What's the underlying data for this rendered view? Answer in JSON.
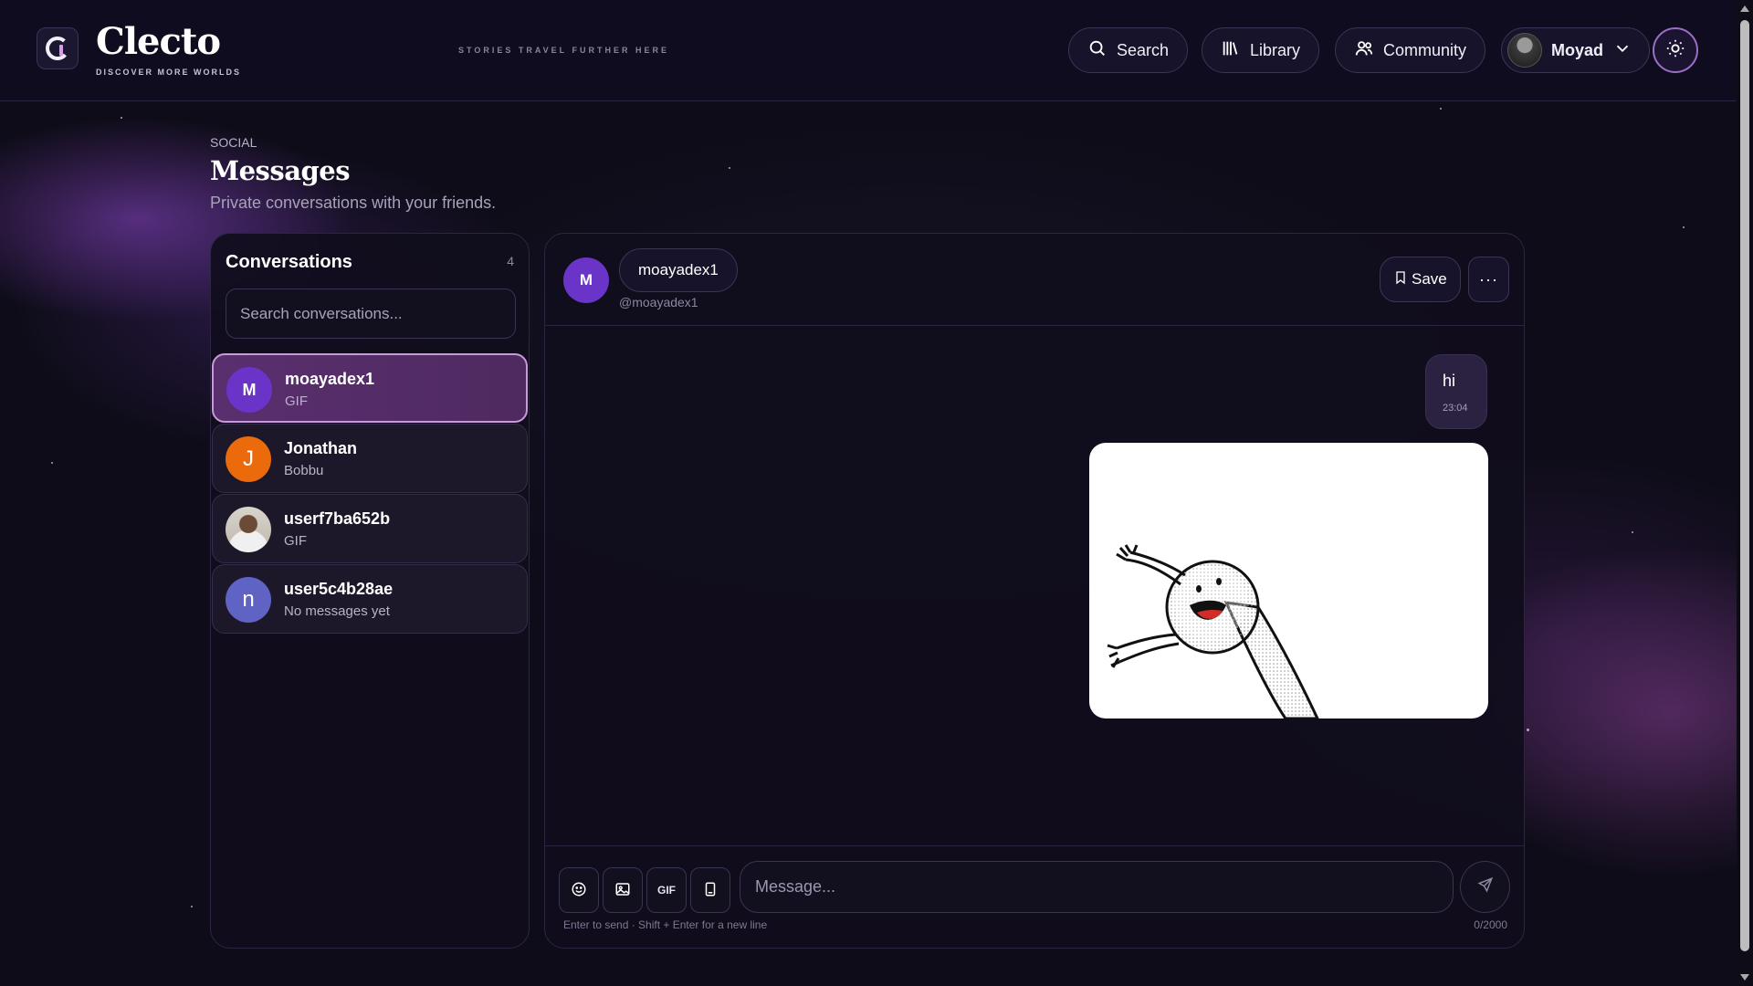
{
  "header": {
    "brand": "Clecto",
    "brand_tagline": "DISCOVER MORE WORLDS",
    "tagline": "STORIES TRAVEL FURTHER HERE",
    "nav": {
      "search": "Search",
      "library": "Library",
      "community": "Community",
      "user": "Moyad"
    }
  },
  "page": {
    "eyebrow": "SOCIAL",
    "title": "Messages",
    "subtitle": "Private conversations with your friends."
  },
  "conversations": {
    "title": "Conversations",
    "count": "4",
    "search_placeholder": "Search conversations...",
    "items": [
      {
        "initial": "M",
        "name": "moayadex1",
        "preview": "GIF",
        "color": "#6a34c8"
      },
      {
        "initial": "J",
        "name": "Jonathan",
        "preview": "Bobbu",
        "color": "#ea6a0c"
      },
      {
        "initial": "",
        "name": "userf7ba652b",
        "preview": "GIF",
        "color": "#cfc8bd"
      },
      {
        "initial": "n",
        "name": "user5c4b28ae",
        "preview": "No messages yet",
        "color": "#5f63c4"
      }
    ]
  },
  "chat": {
    "avatar_initial": "M",
    "name": "moayadex1",
    "handle": "@moayadex1",
    "save_label": "Save",
    "more_label": "···",
    "messages": [
      {
        "text": "hi",
        "time": "23:04"
      }
    ],
    "composer": {
      "gif_label": "GIF",
      "placeholder": "Message...",
      "hint": "Enter to send · Shift + Enter for a new line",
      "char_count": "0/2000"
    }
  },
  "colors": {
    "accent": "#c79ad9",
    "active_bg": "#5a2f6e",
    "chat_avatar": "#6a34c8"
  }
}
